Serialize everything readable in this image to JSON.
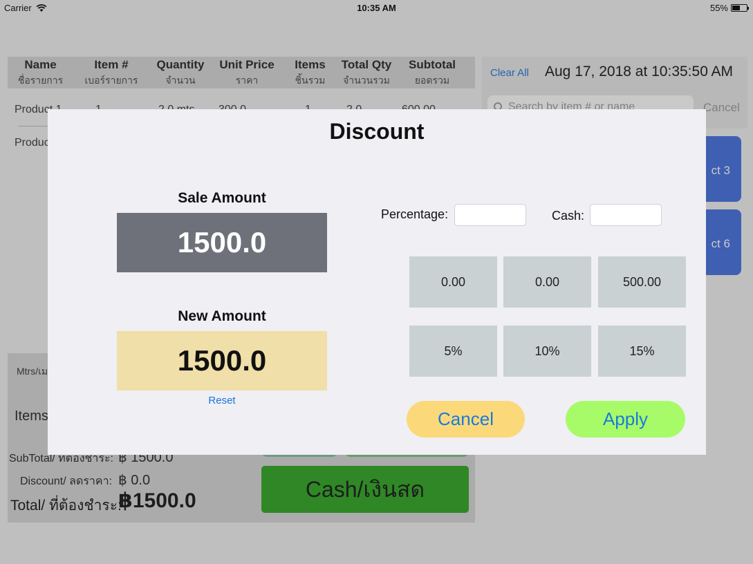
{
  "status_bar": {
    "carrier": "Carrier",
    "time": "10:35 AM",
    "battery": "55%",
    "battery_level": 0.55
  },
  "table": {
    "headers": [
      {
        "en": "Name",
        "th": "ชื่อรายการ"
      },
      {
        "en": "Item #",
        "th": "เบอร์รายการ"
      },
      {
        "en": "Quantity",
        "th": "จำนวน"
      },
      {
        "en": "Unit Price",
        "th": "ราคา"
      },
      {
        "en": "Items",
        "th": "ชิ้นรวม"
      },
      {
        "en": "Total Qty",
        "th": "จำนวนรวม"
      },
      {
        "en": "Subtotal",
        "th": "ยอดรวม"
      }
    ],
    "rows": [
      {
        "name": "Product 1",
        "item": "1",
        "qty": "2.0 mts",
        "price": "300.0",
        "items": "1",
        "total_qty": "2.0",
        "subtotal": "600.00"
      },
      {
        "name": "Produc",
        "item": "",
        "qty": "",
        "price": "",
        "items": "",
        "total_qty": "",
        "subtotal": ""
      }
    ]
  },
  "right_panel": {
    "clear_all": "Clear All",
    "datetime": "Aug 17, 2018 at 10:35:50 AM",
    "search_placeholder": "Search by item # or name",
    "search_cancel": "Cancel",
    "product_buttons": [
      "ct 3",
      "ct 6"
    ]
  },
  "bottom_panel": {
    "mtrs_label": "Mtrs/เม",
    "items_label": "Items",
    "subtotal_label": "SubTotal/ ที่ต้องชำระ:",
    "subtotal_value": "฿ 1500.0",
    "discount_label": "Discount/ ลดราคา:",
    "discount_value": "฿ 0.0",
    "total_label": "Total/ ที่ต้องชำระ:",
    "total_value": "฿1500.0",
    "cash_button": "Cash/เงินสด"
  },
  "modal": {
    "title": "Discount",
    "sale_label": "Sale Amount",
    "sale_value": "1500.0",
    "new_label": "New Amount",
    "new_value": "1500.0",
    "reset": "Reset",
    "percentage_label": "Percentage:",
    "percentage_value": "",
    "cash_label": "Cash:",
    "cash_value": "",
    "quick_amounts": [
      "0.00",
      "0.00",
      "500.00"
    ],
    "quick_percents": [
      "5%",
      "10%",
      "15%"
    ],
    "cancel": "Cancel",
    "apply": "Apply"
  },
  "colors": {
    "accent_blue": "#1a73d9",
    "sale_box": "#6e717a",
    "new_box": "#f0dfa8",
    "cancel_bg": "#fbd97a",
    "apply_bg": "#a8fb68",
    "product_blue": "#3f6de0",
    "cash_green": "#2aa51d"
  }
}
